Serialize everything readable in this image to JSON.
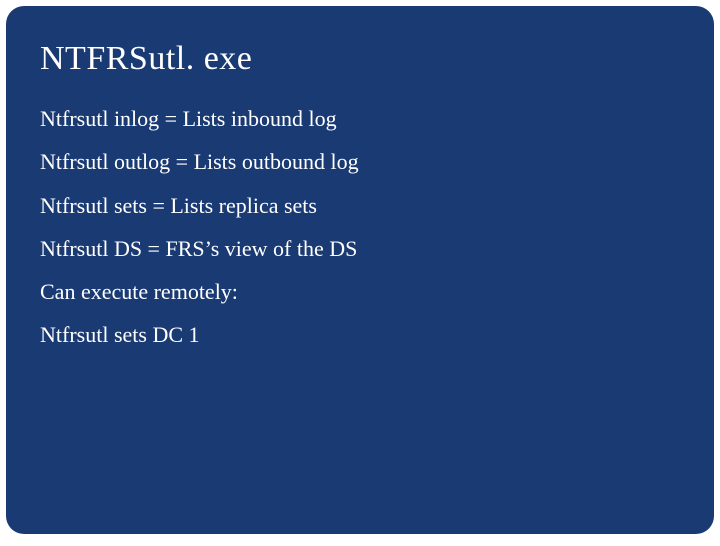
{
  "slide": {
    "title": "NTFRSutl. exe",
    "lines": [
      "Ntfrsutl inlog = Lists inbound log",
      "Ntfrsutl outlog = Lists outbound log",
      "Ntfrsutl sets = Lists replica sets",
      "Ntfrsutl DS = FRS’s view of the DS",
      "Can execute remotely:",
      "Ntfrsutl sets DC 1"
    ]
  }
}
